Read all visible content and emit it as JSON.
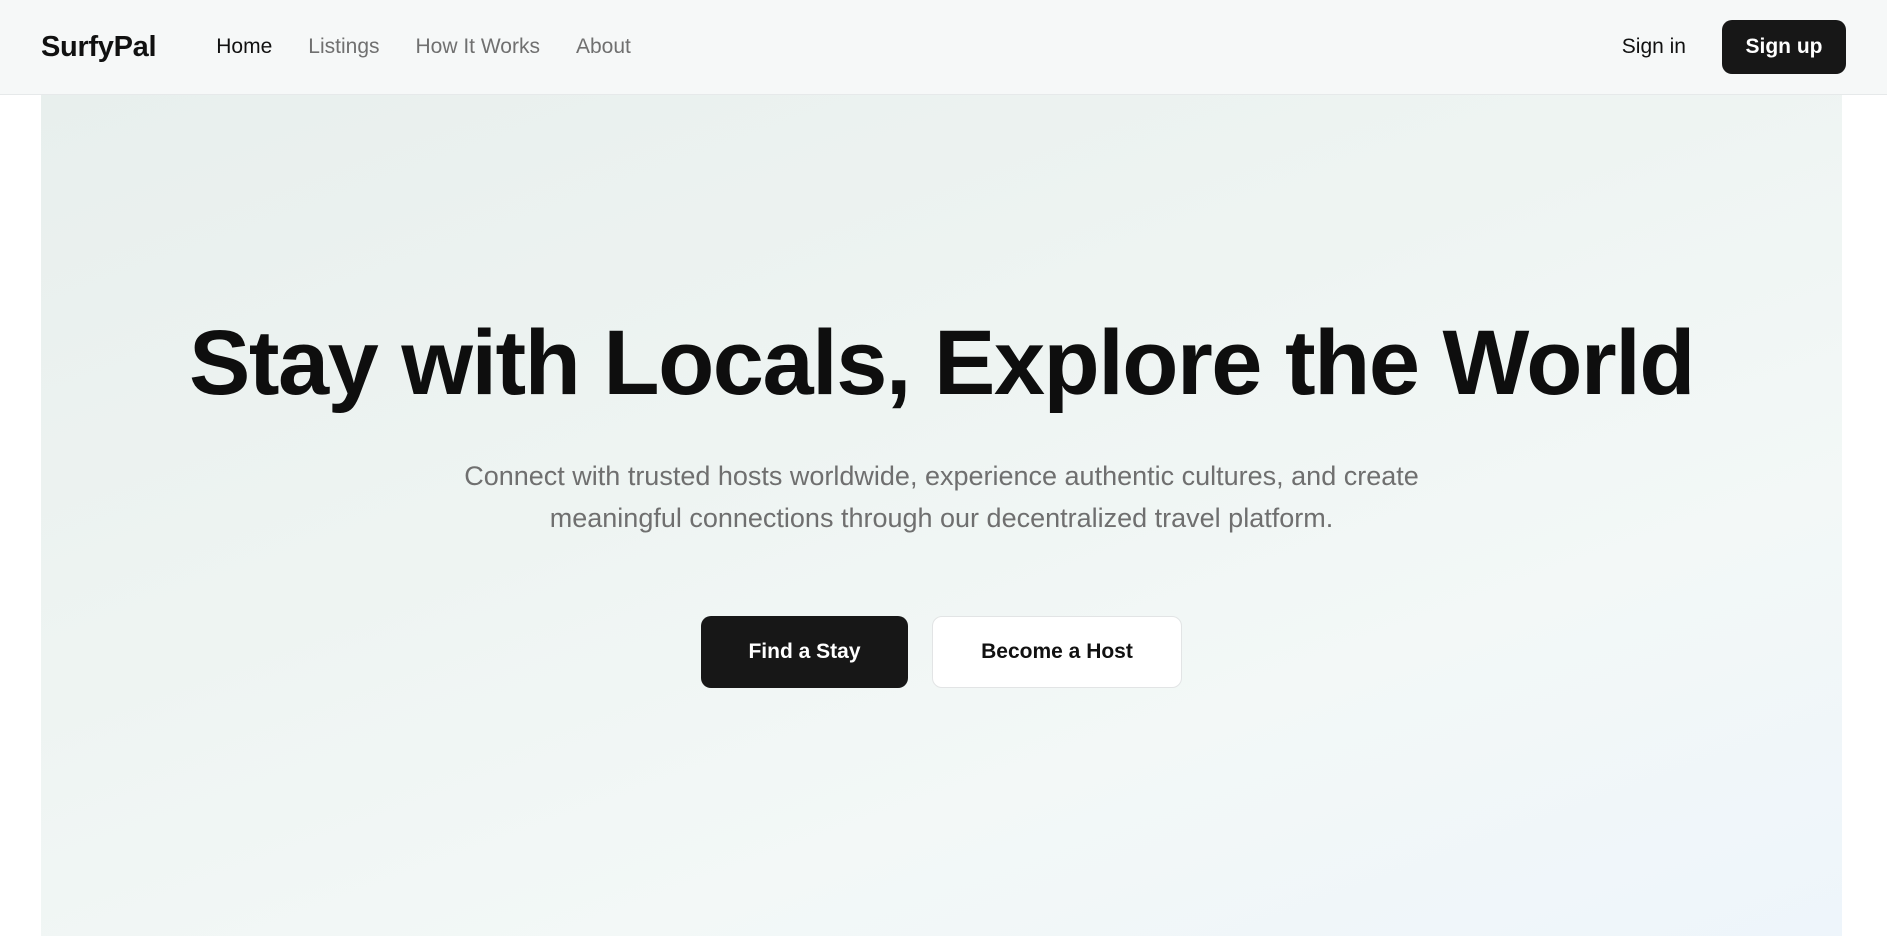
{
  "brand": {
    "name": "SurfyPal"
  },
  "nav": {
    "links": [
      {
        "label": "Home",
        "active": true
      },
      {
        "label": "Listings",
        "active": false
      },
      {
        "label": "How It Works",
        "active": false
      },
      {
        "label": "About",
        "active": false
      }
    ],
    "sign_in": "Sign in",
    "sign_up": "Sign up"
  },
  "hero": {
    "title": "Stay with Locals, Explore the World",
    "subtitle": "Connect with trusted hosts worldwide, experience authentic cultures, and create meaningful connections through our decentralized travel platform.",
    "primary_cta": "Find a Stay",
    "secondary_cta": "Become a Host"
  },
  "colors": {
    "primary": "#171717",
    "muted_text": "#6f6f6f",
    "hero_bg_start": "#e8efed",
    "hero_bg_end": "#eef5fb"
  }
}
